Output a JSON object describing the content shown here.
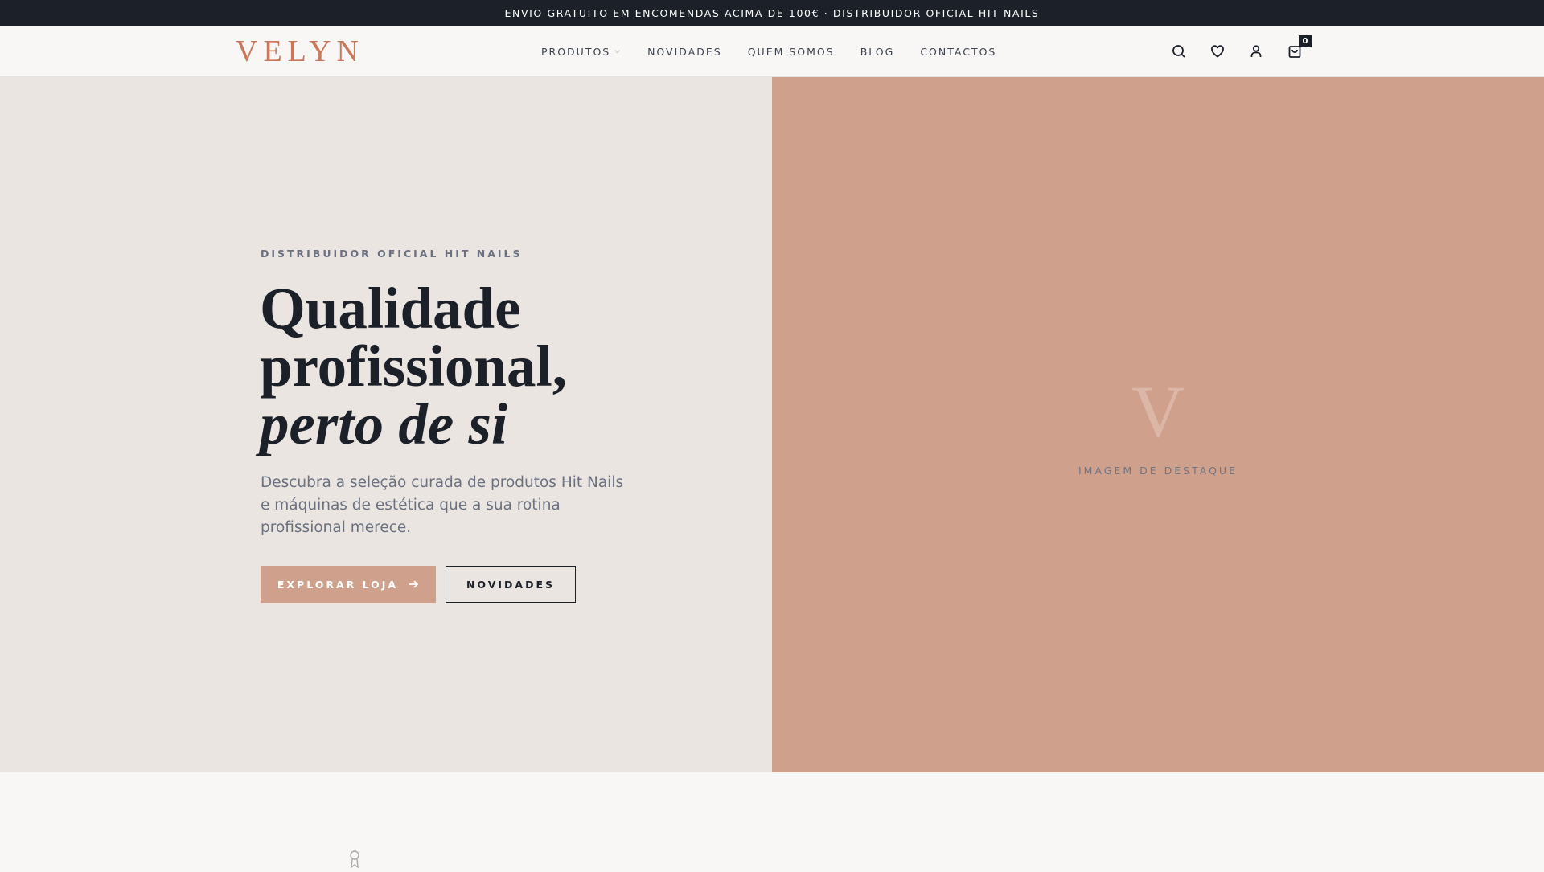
{
  "announcement": "ENVIO GRATUITO EM ENCOMENDAS ACIMA DE 100€ · DISTRIBUIDOR OFICIAL HIT NAILS",
  "header": {
    "logo": "VELYN",
    "nav": [
      {
        "label": "PRODUTOS"
      },
      {
        "label": "NOVIDADES"
      },
      {
        "label": "QUEM SOMOS"
      },
      {
        "label": "BLOG"
      },
      {
        "label": "CONTACTOS"
      }
    ],
    "cart_count": "0"
  },
  "hero": {
    "eyebrow": "DISTRIBUIDOR OFICIAL HIT NAILS",
    "title_line1": "Qualidade",
    "title_line2": "profissional,",
    "title_italic": "perto de si",
    "lead": "Descubra a seleção curada de produtos Hit Nails e máquinas de estética que a sua rotina profissional merece.",
    "primary_button": "EXPLORAR LOJA",
    "secondary_button": "NOVIDADES",
    "placeholder_letter": "V",
    "placeholder_label": "IMAGEM DE DESTAQUE"
  },
  "colors": {
    "accent": "#cfa08c",
    "dark": "#1c2029",
    "logo": "#c9785a"
  }
}
